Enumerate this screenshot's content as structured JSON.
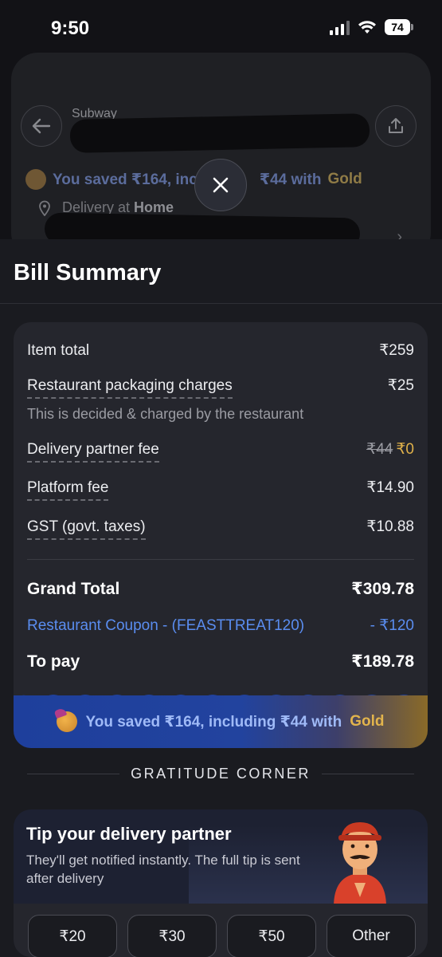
{
  "status_bar": {
    "time": "9:50",
    "battery": "74"
  },
  "background": {
    "restaurant_name": "Subway",
    "saved_banner": {
      "prefix": "You saved ₹164, inc",
      "suffix": "₹44 with",
      "gold": "Gold"
    },
    "delivery": {
      "label": "Delivery at",
      "place": "Home"
    }
  },
  "sheet": {
    "title": "Bill Summary",
    "rows": {
      "item_total": {
        "label": "Item total",
        "value": "₹259"
      },
      "packaging": {
        "label": "Restaurant packaging charges",
        "value": "₹25",
        "note": "This is decided & charged by the restaurant"
      },
      "delivery_fee": {
        "label": "Delivery partner fee",
        "old_value": "₹44",
        "value": "₹0"
      },
      "platform_fee": {
        "label": "Platform fee",
        "value": "₹14.90"
      },
      "gst": {
        "label": "GST (govt. taxes)",
        "value": "₹10.88"
      },
      "grand_total": {
        "label": "Grand Total",
        "value": "₹309.78"
      },
      "coupon": {
        "label": "Restaurant Coupon - (FEASTTREAT120)",
        "value": "- ₹120"
      },
      "to_pay": {
        "label": "To pay",
        "value": "₹189.78"
      }
    },
    "saved_banner": {
      "text": "You saved ₹164, including ₹44 with",
      "gold": "Gold"
    },
    "gratitude_heading": "GRATITUDE CORNER",
    "tip": {
      "title": "Tip your delivery partner",
      "subtitle": "They'll get notified instantly. The full tip is sent after delivery",
      "options": [
        "₹20",
        "₹30",
        "₹50",
        "Other"
      ]
    }
  },
  "colors": {
    "accent_blue": "#5a8df0",
    "gold": "#e0b14a",
    "banner_blue": "#1e3f9c"
  }
}
